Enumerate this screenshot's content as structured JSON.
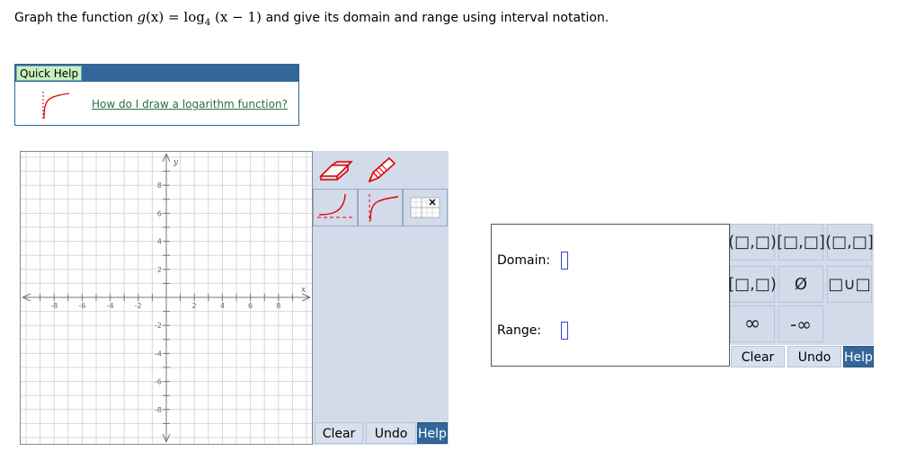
{
  "question": {
    "prefix": "Graph the function",
    "func_name": "g",
    "func_arg": "(x)",
    "equals": "=",
    "log_text": "log",
    "log_base": "4",
    "log_arg": "(x − 1)",
    "suffix": "and give its domain and range using interval notation."
  },
  "quick_help": {
    "title": "Quick Help",
    "icon": "log-graph-thumbnail-icon",
    "link": "How do I draw a logarithm function?"
  },
  "graph": {
    "x_axis_label": "x",
    "y_axis_label": "y",
    "x_range": [
      -10,
      10
    ],
    "y_range": [
      -10,
      10
    ],
    "grid": true,
    "x_ticks": [
      "-8",
      "-6",
      "-4",
      "-2",
      "2",
      "4",
      "6",
      "8"
    ],
    "y_ticks": [
      "8",
      "6",
      "4",
      "2",
      "-2",
      "-4",
      "-6",
      "-8"
    ]
  },
  "tools": [
    {
      "name": "eraser-tool",
      "icon": "eraser-icon"
    },
    {
      "name": "pencil-tool",
      "icon": "pencil-icon"
    },
    {
      "name": "exponential-tool",
      "icon": "exponential-curve-icon"
    },
    {
      "name": "logarithm-tool",
      "icon": "logarithm-curve-icon"
    },
    {
      "name": "point-tool",
      "icon": "point-grid-icon"
    }
  ],
  "graph_buttons": {
    "clear": "Clear",
    "undo": "Undo",
    "help": "Help"
  },
  "interval": {
    "domain_label": "Domain:",
    "range_label": "Range:",
    "domain_value": "",
    "range_value": ""
  },
  "palette": {
    "buttons": [
      {
        "name": "open-open-interval-button",
        "label": "(□,□)"
      },
      {
        "name": "closed-closed-interval-button",
        "label": "[□,□]"
      },
      {
        "name": "open-closed-interval-button",
        "label": "(□,□]"
      },
      {
        "name": "closed-open-interval-button",
        "label": "[□,□)"
      },
      {
        "name": "empty-set-button",
        "label": "Ø"
      },
      {
        "name": "union-button",
        "label": "□∪□"
      },
      {
        "name": "infinity-button",
        "label": "∞"
      },
      {
        "name": "negative-infinity-button",
        "label": "-∞"
      }
    ],
    "clear": "Clear",
    "undo": "Undo",
    "help": "Help"
  },
  "colors": {
    "accent": "#336699",
    "panel": "#d3dbea",
    "curve": "#e00000",
    "field_border": "#3346d0"
  }
}
